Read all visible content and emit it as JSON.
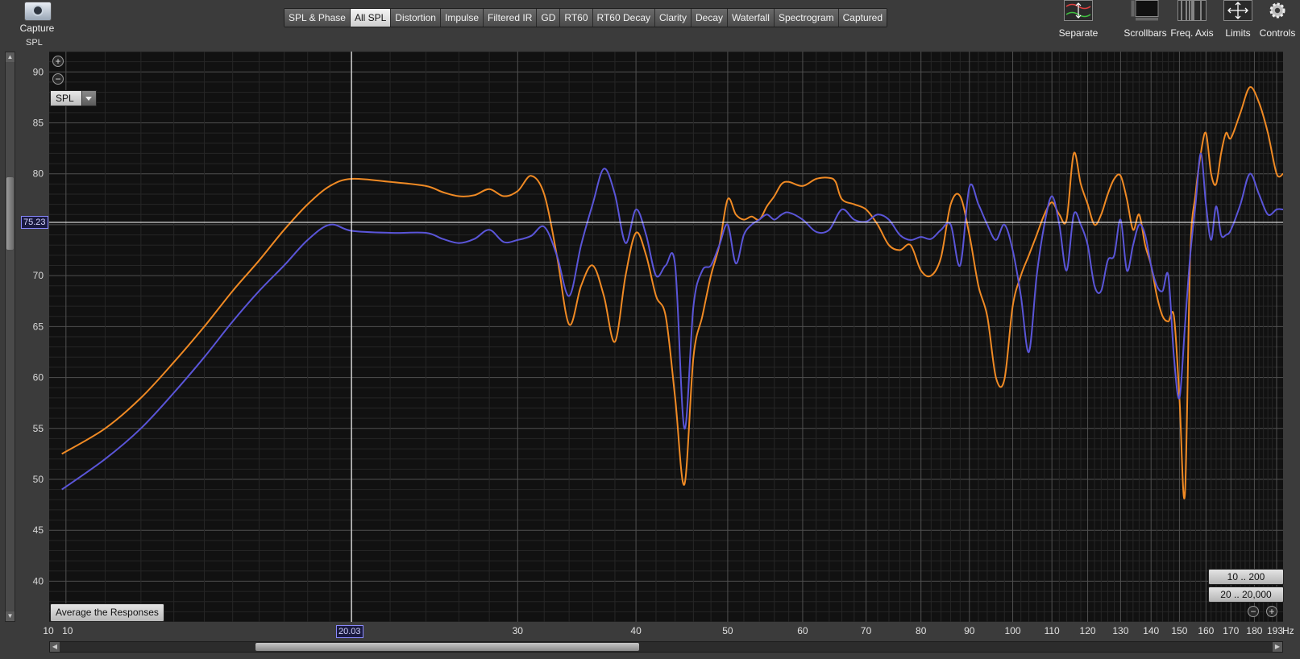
{
  "toolbar": {
    "capture_label": "Capture",
    "panel_title": "SPL",
    "tabs": [
      "SPL & Phase",
      "All SPL",
      "Distortion",
      "Impulse",
      "Filtered IR",
      "GD",
      "RT60",
      "RT60 Decay",
      "Clarity",
      "Decay",
      "Waterfall",
      "Spectrogram",
      "Captured"
    ],
    "active_tab": "All SPL",
    "tools": [
      "Separate",
      "Scrollbars",
      "Freq. Axis",
      "Limits",
      "Controls"
    ]
  },
  "controls": {
    "spl_select": "SPL",
    "average_button": "Average the Responses",
    "range_buttons": [
      "10 .. 200",
      "20 .. 20,000"
    ],
    "cursor_y": "75.23",
    "cursor_x": "20.03"
  },
  "colors": {
    "series_orange": "#f08a24",
    "series_blue": "#5a55d8",
    "background": "#111111",
    "grid": "#3c3c3c",
    "cursor": "#ffffff"
  },
  "chart_data": {
    "type": "line",
    "xscale": "log",
    "xlim": [
      9.6,
      193
    ],
    "ylim": [
      36,
      92
    ],
    "x_unit": "Hz",
    "x_ticks": [
      "10",
      "10",
      "20",
      "30",
      "40",
      "50",
      "60",
      "70",
      "80",
      "90",
      "100",
      "110",
      "120",
      "130",
      "140",
      "150",
      "160",
      "170",
      "180",
      "193"
    ],
    "y_ticks": [
      40,
      45,
      50,
      55,
      60,
      65,
      70,
      75,
      80,
      85,
      90
    ],
    "grid": true,
    "cursor": {
      "x": 20.03,
      "y": 75.23
    },
    "series": [
      {
        "color": "#f08a24",
        "points": [
          [
            9.9,
            52.5
          ],
          [
            11,
            55
          ],
          [
            12,
            58
          ],
          [
            13,
            61.5
          ],
          [
            14,
            65
          ],
          [
            15,
            68.5
          ],
          [
            16,
            71.5
          ],
          [
            17,
            74.5
          ],
          [
            18,
            77
          ],
          [
            19,
            78.8
          ],
          [
            20.03,
            79.5
          ],
          [
            22,
            79.2
          ],
          [
            24,
            78.8
          ],
          [
            25,
            78.2
          ],
          [
            26,
            77.8
          ],
          [
            27,
            77.9
          ],
          [
            28,
            78.5
          ],
          [
            29,
            77.8
          ],
          [
            30,
            78.3
          ],
          [
            31,
            79.8
          ],
          [
            32,
            78
          ],
          [
            33,
            72
          ],
          [
            34,
            65.2
          ],
          [
            35,
            69
          ],
          [
            36,
            71
          ],
          [
            37,
            68
          ],
          [
            38,
            63.5
          ],
          [
            39,
            70
          ],
          [
            40,
            74.2
          ],
          [
            41,
            72
          ],
          [
            42,
            68
          ],
          [
            43,
            66
          ],
          [
            44,
            58
          ],
          [
            45,
            49.5
          ],
          [
            46,
            62
          ],
          [
            47,
            66
          ],
          [
            48,
            70
          ],
          [
            49,
            73
          ],
          [
            50,
            77.5
          ],
          [
            51,
            76
          ],
          [
            52,
            75.5
          ],
          [
            53,
            75.8
          ],
          [
            54,
            75.5
          ],
          [
            55,
            76.8
          ],
          [
            56,
            77.8
          ],
          [
            57,
            79
          ],
          [
            58,
            79.2
          ],
          [
            60,
            78.8
          ],
          [
            62,
            79.5
          ],
          [
            64,
            79.6
          ],
          [
            65,
            79.2
          ],
          [
            66,
            77.5
          ],
          [
            68,
            77
          ],
          [
            70,
            76.5
          ],
          [
            72,
            75
          ],
          [
            74,
            73
          ],
          [
            76,
            72.5
          ],
          [
            78,
            73
          ],
          [
            80,
            70.5
          ],
          [
            82,
            70
          ],
          [
            84,
            71.8
          ],
          [
            86,
            77
          ],
          [
            88,
            77.8
          ],
          [
            90,
            74
          ],
          [
            92,
            69
          ],
          [
            94,
            66
          ],
          [
            96,
            60
          ],
          [
            98,
            59.8
          ],
          [
            100,
            67
          ],
          [
            102,
            70
          ],
          [
            104,
            72
          ],
          [
            106,
            74
          ],
          [
            108,
            76
          ],
          [
            110,
            77.2
          ],
          [
            112,
            76
          ],
          [
            114,
            75.5
          ],
          [
            116,
            82
          ],
          [
            118,
            79
          ],
          [
            120,
            77
          ],
          [
            122,
            75
          ],
          [
            124,
            76
          ],
          [
            126,
            78
          ],
          [
            128,
            79.5
          ],
          [
            130,
            79.8
          ],
          [
            132,
            77.5
          ],
          [
            134,
            74.5
          ],
          [
            136,
            76
          ],
          [
            138,
            73
          ],
          [
            140,
            71
          ],
          [
            142,
            68
          ],
          [
            144,
            66
          ],
          [
            146,
            65.5
          ],
          [
            148,
            66
          ],
          [
            150,
            58
          ],
          [
            152,
            48.5
          ],
          [
            154,
            72
          ],
          [
            156,
            78
          ],
          [
            158,
            82
          ],
          [
            160,
            84
          ],
          [
            162,
            80
          ],
          [
            164,
            79
          ],
          [
            166,
            82
          ],
          [
            168,
            84
          ],
          [
            170,
            83.5
          ],
          [
            174,
            86
          ],
          [
            178,
            88.5
          ],
          [
            182,
            87
          ],
          [
            186,
            84
          ],
          [
            190,
            80
          ],
          [
            193,
            80
          ]
        ]
      },
      {
        "color": "#5a55d8",
        "points": [
          [
            9.9,
            49
          ],
          [
            11,
            52
          ],
          [
            12,
            55
          ],
          [
            13,
            58.5
          ],
          [
            14,
            62
          ],
          [
            15,
            65.5
          ],
          [
            16,
            68.5
          ],
          [
            17,
            71
          ],
          [
            18,
            73.5
          ],
          [
            19,
            75
          ],
          [
            20.03,
            74.4
          ],
          [
            22,
            74.2
          ],
          [
            24,
            74.2
          ],
          [
            25,
            73.6
          ],
          [
            26,
            73.2
          ],
          [
            27,
            73.6
          ],
          [
            28,
            74.5
          ],
          [
            29,
            73.3
          ],
          [
            30,
            73.5
          ],
          [
            31,
            73.9
          ],
          [
            32,
            74.8
          ],
          [
            33,
            72
          ],
          [
            34,
            68
          ],
          [
            35,
            73
          ],
          [
            36,
            77
          ],
          [
            37,
            80.5
          ],
          [
            38,
            78
          ],
          [
            39,
            73.2
          ],
          [
            40,
            76.5
          ],
          [
            41,
            74
          ],
          [
            42,
            70
          ],
          [
            43,
            71
          ],
          [
            44,
            71
          ],
          [
            45,
            55
          ],
          [
            46,
            67
          ],
          [
            47,
            70.5
          ],
          [
            48,
            71
          ],
          [
            49,
            73
          ],
          [
            50,
            75
          ],
          [
            51,
            71.2
          ],
          [
            52,
            74
          ],
          [
            53,
            75
          ],
          [
            54,
            75.5
          ],
          [
            55,
            76
          ],
          [
            56,
            75.5
          ],
          [
            57,
            76
          ],
          [
            58,
            76.2
          ],
          [
            60,
            75.5
          ],
          [
            62,
            74.3
          ],
          [
            64,
            74.5
          ],
          [
            66,
            76.5
          ],
          [
            68,
            75.5
          ],
          [
            70,
            75.3
          ],
          [
            72,
            76
          ],
          [
            74,
            75.5
          ],
          [
            76,
            74
          ],
          [
            78,
            73.5
          ],
          [
            80,
            73.8
          ],
          [
            82,
            73.6
          ],
          [
            84,
            74.5
          ],
          [
            86,
            75
          ],
          [
            88,
            71
          ],
          [
            90,
            78.7
          ],
          [
            92,
            77
          ],
          [
            94,
            75
          ],
          [
            96,
            73.5
          ],
          [
            98,
            75
          ],
          [
            100,
            72.5
          ],
          [
            102,
            68
          ],
          [
            104,
            62.5
          ],
          [
            106,
            70
          ],
          [
            108,
            75
          ],
          [
            110,
            77.8
          ],
          [
            112,
            75
          ],
          [
            114,
            70.5
          ],
          [
            116,
            76
          ],
          [
            118,
            75
          ],
          [
            120,
            73
          ],
          [
            122,
            69
          ],
          [
            124,
            68.5
          ],
          [
            126,
            71.5
          ],
          [
            128,
            72
          ],
          [
            130,
            75.5
          ],
          [
            132,
            70.5
          ],
          [
            134,
            73
          ],
          [
            136,
            75
          ],
          [
            138,
            74
          ],
          [
            140,
            71
          ],
          [
            142,
            69
          ],
          [
            144,
            68.5
          ],
          [
            146,
            70
          ],
          [
            148,
            62
          ],
          [
            150,
            58
          ],
          [
            152,
            65
          ],
          [
            154,
            72
          ],
          [
            156,
            77
          ],
          [
            158,
            82
          ],
          [
            160,
            77
          ],
          [
            162,
            73.5
          ],
          [
            164,
            76.8
          ],
          [
            166,
            74
          ],
          [
            168,
            74
          ],
          [
            170,
            74.5
          ],
          [
            174,
            77
          ],
          [
            178,
            80
          ],
          [
            182,
            78
          ],
          [
            186,
            76
          ],
          [
            190,
            76.5
          ],
          [
            193,
            76.5
          ]
        ]
      }
    ]
  }
}
